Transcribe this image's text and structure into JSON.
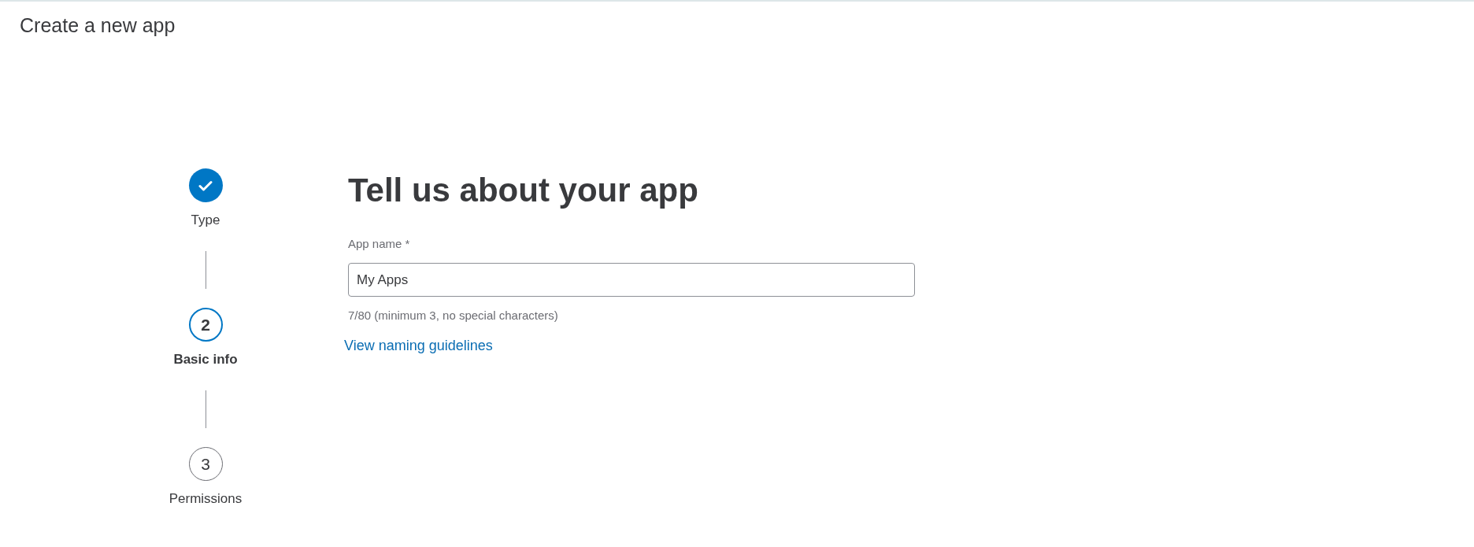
{
  "page_title": "Create a new app",
  "steps": [
    {
      "label": "Type",
      "completed": true,
      "selected": false
    },
    {
      "label": "Basic info",
      "number": "2",
      "completed": false,
      "selected": true
    },
    {
      "label": "Permissions",
      "number": "3",
      "completed": false,
      "selected": false
    }
  ],
  "form": {
    "heading": "Tell us about your app",
    "field_label": "App name *",
    "value": "My Apps",
    "helper": "7/80 (minimum 3, no special characters)",
    "link": "View naming guidelines"
  }
}
